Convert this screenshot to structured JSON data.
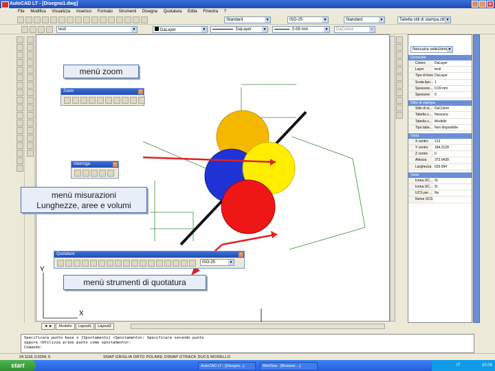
{
  "window": {
    "title": "AutoCAD LT - [Disegno1.dwg]"
  },
  "menu": [
    "File",
    "Modifica",
    "Visualizza",
    "Inserisci",
    "Formato",
    "Strumenti",
    "Disegna",
    "Quotatura",
    "Edita",
    "Finestra",
    "?"
  ],
  "styles_toolbar": {
    "text_style": "Standard",
    "dim_style": "ISO-25",
    "table_style": "Standard",
    "plot_style": "Tabella stili di stampa.ctb"
  },
  "layers_toolbar": {
    "layer": "testi",
    "color": "DaLayer",
    "linetype": "DaLayer",
    "lineweight": "0.09 mm",
    "plotstyle": "DaColore"
  },
  "callouts": {
    "zoom": "menù zoom",
    "measure": "menù misurazioni\nLunghezze, aree e volumi",
    "dim": "menù strumenti di quotatura"
  },
  "panels": {
    "zoom_title": "Zoom",
    "inquiry_title": "Interroga",
    "dim_title": "Quotature",
    "dim_style_value": "ISO-25"
  },
  "axis": {
    "x": "X",
    "y": "Y"
  },
  "tabs": [
    "Modello",
    "Layout1",
    "Layout2"
  ],
  "properties": {
    "selector": "Nessuna selezione",
    "sections": [
      {
        "title": "Generale",
        "rows": [
          [
            "Colore",
            "DaLayer"
          ],
          [
            "Layer",
            "testi"
          ],
          [
            "Tipo di linea",
            "DaLayer"
          ],
          [
            "Scala tipo...",
            "1"
          ],
          [
            "Spessore...",
            "0.09 mm"
          ],
          [
            "Spessore",
            "0"
          ]
        ]
      },
      {
        "title": "Stile di stampa",
        "rows": [
          [
            "Stile di st...",
            "DaColore"
          ],
          [
            "Tabella s...",
            "Nessuna"
          ],
          [
            "Tabella s...",
            "Modello"
          ],
          [
            "Tipo tabe...",
            "Non disponibile"
          ]
        ]
      },
      {
        "title": "Vista",
        "rows": [
          [
            "X centro",
            "213"
          ],
          [
            "Y centro",
            "184.2128"
          ],
          [
            "Z centro",
            "0"
          ],
          [
            "Altezza",
            "373.0438"
          ],
          [
            "Larghezza",
            "633.594"
          ]
        ]
      },
      {
        "title": "Varie",
        "rows": [
          [
            "Icona UC...",
            "Sì"
          ],
          [
            "Icona UC...",
            "Sì"
          ],
          [
            "UCS per ...",
            "No"
          ],
          [
            "Nome UCS",
            ""
          ]
        ]
      }
    ]
  },
  "command_lines": [
    "Specificare punto base o [Spostamento] <Spostamento>: Specificare secondo punto",
    "oppure <Utilizza primo punto come spostamento>:",
    "Comando:"
  ],
  "status": {
    "coords": "24.1118, 0.6204, 0",
    "toggles": [
      "SNAP",
      "GRIGLIA",
      "ORTO",
      "POLARE",
      "OSNAP",
      "OTRACK",
      "DUCS",
      "MODELLO"
    ]
  },
  "taskbar": {
    "start": "start",
    "tasks": [
      "AutoCAD LT - [Disegno...]",
      "WinFlow - [Browser ...]"
    ],
    "lang": "IT",
    "clock": "10.05"
  },
  "colors": {
    "circle_top": "#f5b800",
    "circle_yellow": "#ffee00",
    "circle_blue": "#1f33d6",
    "circle_red": "#ef1616",
    "arrow": "#e02020",
    "dim_lines": "#3a8a3a"
  }
}
